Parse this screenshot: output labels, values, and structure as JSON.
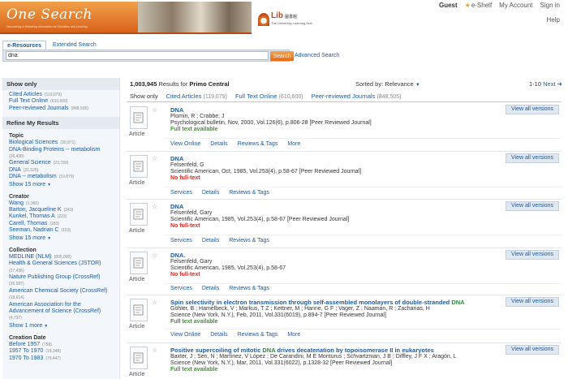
{
  "header": {
    "logo_text": "One Search",
    "logo_subtitle": "Discovering & Delivering Information for Education and Learning",
    "lib_name": "Lib",
    "lib_name_cn": "圖書館",
    "lib_tagline": "The University Learning Hub",
    "top_links": {
      "guest": "Guest",
      "eshelf": "e-Shelf",
      "my_account": "My Account",
      "sign_in": "Sign in"
    },
    "help": "Help"
  },
  "search": {
    "tabs": [
      "e-Resources",
      "Extended Search"
    ],
    "query": "dna",
    "button": "Search",
    "advanced": "Advanced Search"
  },
  "results_header": {
    "count": "1,003,945",
    "count_label": "Results for",
    "source": "Primo Central",
    "sort_label": "Sorted by:",
    "sort_value": "Relevance",
    "pager_range": "1-10",
    "pager_next": "Next ➜",
    "filters": [
      {
        "label": "Show only",
        "count": ""
      },
      {
        "label": "Cited Articles",
        "count": "(119,079)"
      },
      {
        "label": "Full Text Online",
        "count": "(610,600)"
      },
      {
        "label": "Peer-reviewed Journals",
        "count": "(848,505)"
      }
    ]
  },
  "sidebar": {
    "show_only_title": "Show only",
    "show_only": [
      {
        "label": "Cited Articles",
        "count": "(119,079)"
      },
      {
        "label": "Full Text Online",
        "count": "(610,600)"
      },
      {
        "label": "Peer-reviewed Journals",
        "count": "(848,505)"
      }
    ],
    "refine_title": "Refine My Results",
    "topic_title": "Topic",
    "topic": [
      {
        "label": "Biological Sciences",
        "count": "(30,971)"
      },
      {
        "label": "DNA-Binding Proteins -- metabolism",
        "count": "(26,430)"
      },
      {
        "label": "General Science",
        "count": "(23,789)"
      },
      {
        "label": "DNA",
        "count": "(21,525)"
      },
      {
        "label": "DNA -- metabolism",
        "count": "(19,879)"
      }
    ],
    "topic_more": "Show 15 more",
    "creator_title": "Creator",
    "creator": [
      {
        "label": "Wang",
        "count": "(1,360)"
      },
      {
        "label": "Barton, Jacqueline K",
        "count": "(243)"
      },
      {
        "label": "Kunkel, Thomas A",
        "count": "(223)"
      },
      {
        "label": "Carell, Thomas",
        "count": "(183)"
      },
      {
        "label": "Seeman, Nadrian C",
        "count": "(153)"
      }
    ],
    "creator_more": "Show 15 more",
    "collection_title": "Collection",
    "collection": [
      {
        "label": "MEDLINE (NLM)",
        "count": "(805,000)"
      },
      {
        "label": "Health & General Sciences (JSTOR)",
        "count": "(27,436)"
      },
      {
        "label": "Nature Publishing Group (CrossRef)",
        "count": "(26,587)"
      },
      {
        "label": "American Chemical Society (CrossRef)",
        "count": "(18,614)"
      },
      {
        "label": "American Association for the Advancement of Science (CrossRef)",
        "count": "(4,737)"
      }
    ],
    "collection_more": "Show 1 more",
    "date_title": "Creation Date",
    "dates": [
      {
        "label": "Before 1957",
        "count": "(758)"
      },
      {
        "label": "1957 To 1970",
        "count": "(19,348)"
      },
      {
        "label": "1970 To 1983",
        "count": "(79,447)"
      }
    ]
  },
  "results": [
    {
      "title": "DNA",
      "line1": "Plomin, R ; Crabbe, J",
      "line2": "Psychological bulletin, Nov, 2000, Vol.126(6), p.806-28 [Peer Reviewed Journal]",
      "availability": "Full text available",
      "actions": [
        "View Online",
        "Details",
        "Reviews & Tags",
        "More"
      ],
      "view_all": "View all versions",
      "type": "Article"
    },
    {
      "title": "DNA",
      "line1": "Felsenfeld, G",
      "line2": "Scientific American, Oct, 1985, Vol.253(4), p.58-67 [Peer Reviewed Journal]",
      "availability": "No full-text",
      "actions": [
        "Services",
        "Details",
        "Reviews & Tags"
      ],
      "view_all": "View all versions",
      "type": "Article"
    },
    {
      "title": "DNA",
      "line1": "Felsenfeld, Gary",
      "line2": "Scientific American, 1985, Vol.253(4), p.58-67 [Peer Reviewed Journal]",
      "availability": "No full-text",
      "actions": [
        "Services",
        "Details",
        "Reviews & Tags"
      ],
      "view_all": "View all versions",
      "type": "Article"
    },
    {
      "title": "DNA.",
      "line1": "Felsenfeld, Gary",
      "line2": "Scientific American, 1985, Vol.253(4), p.58-67",
      "availability": "No full-text",
      "actions": [
        "Services",
        "Details",
        "Reviews & Tags"
      ],
      "view_all": "View all versions",
      "type": "Article"
    },
    {
      "title_pre": "Spin selectivity in electron transmission through self-assembled monolayers of double-stranded ",
      "title_hl": "DNA",
      "line1": "Göhler, B ; Hamelbeck, V ; Markus, T Z ; Kettner, M ; Hanne, G F ; Vager, Z ; Naaman, R ; Zacharias, H",
      "line2": "Science (New York, N.Y.), Feb, 2011, Vol.331(6019), p.894-7 [Peer Reviewed Journal]",
      "availability": "Full text available",
      "actions": [
        "View Online",
        "Details",
        "Reviews & Tags",
        "More"
      ],
      "view_all": "View all versions",
      "type": "Article"
    },
    {
      "title_pre": "Positive supercoiling of mitotic ",
      "title_hl": "DNA",
      "title_post": " drives decatenation by topoisomerase II in eukaryotes",
      "line1": "Baxter, J ; Sen, N ; Martínez, V López ; De Carandini, M E Monturus ; Schvartzman, J B ; Diffley, J F X ; Aragón, L",
      "line2": "Science (New York, N.Y.), Mar, 2011, Vol.331(6022), p.1328-32 [Peer Reviewed Journal]",
      "availability": "Full text available",
      "actions": [],
      "view_all": "View all versions",
      "type": "Article"
    }
  ]
}
